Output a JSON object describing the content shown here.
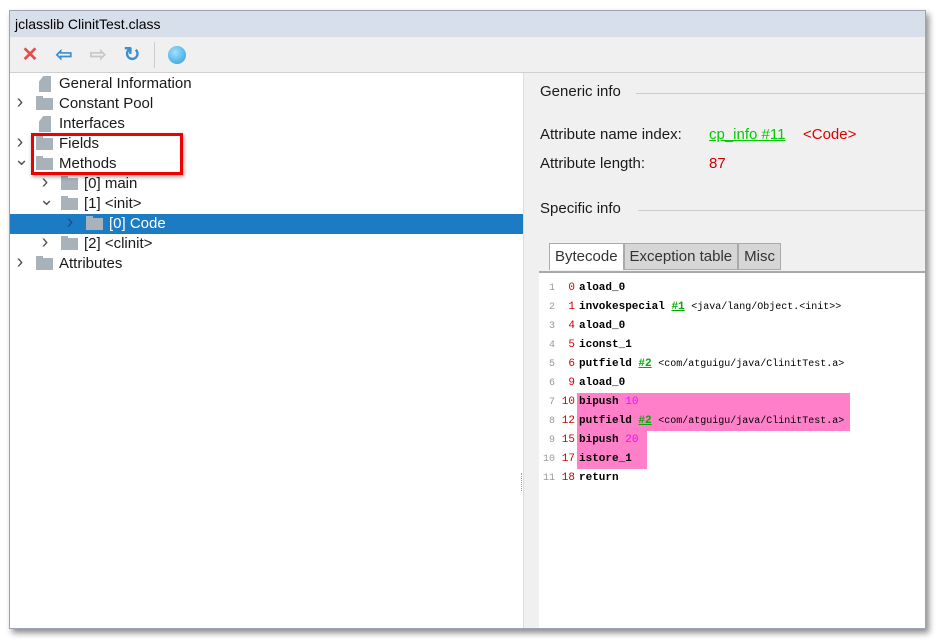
{
  "window": {
    "title": "jclasslib ClinitTest.class"
  },
  "toolbar": {
    "icons": [
      "close-icon",
      "back-icon",
      "forward-icon",
      "refresh-icon",
      "web-icon"
    ]
  },
  "tree": [
    {
      "label": "General Information",
      "level": 0,
      "kind": "file",
      "arrow": ""
    },
    {
      "label": "Constant Pool",
      "level": 0,
      "kind": "folder",
      "arrow": "collapsed"
    },
    {
      "label": "Interfaces",
      "level": 0,
      "kind": "file",
      "arrow": ""
    },
    {
      "label": "Fields",
      "level": 0,
      "kind": "folder",
      "arrow": "collapsed"
    },
    {
      "label": "Methods",
      "level": 0,
      "kind": "folder",
      "arrow": "expanded"
    },
    {
      "label": "[0] main",
      "level": 1,
      "kind": "folder",
      "arrow": "collapsed"
    },
    {
      "label": "[1] <init>",
      "level": 1,
      "kind": "folder",
      "arrow": "expanded"
    },
    {
      "label": "[0] Code",
      "level": 2,
      "kind": "folder",
      "arrow": "collapsed",
      "selected": true
    },
    {
      "label": "[2] <clinit>",
      "level": 1,
      "kind": "folder",
      "arrow": "collapsed"
    },
    {
      "label": "Attributes",
      "level": 0,
      "kind": "folder",
      "arrow": "collapsed"
    }
  ],
  "generic": {
    "title": "Generic info",
    "name_index_label": "Attribute name index:",
    "name_index_link": "cp_info #11",
    "name_index_value": "<Code>",
    "length_label": "Attribute length:",
    "length_value": "87"
  },
  "specific": {
    "title": "Specific info",
    "tabs": [
      "Bytecode",
      "Exception table",
      "Misc"
    ],
    "active_tab": "Bytecode"
  },
  "colors": {
    "selection": "#1b7cc4",
    "highlight": "#ff80c8",
    "link": "#00aa00",
    "value": "#cc0000"
  },
  "bytecode": [
    {
      "line": "1",
      "offset": "0",
      "op": "aload_0",
      "ref": "",
      "comment": "",
      "arg": ""
    },
    {
      "line": "2",
      "offset": "1",
      "op": "invokespecial",
      "ref": "#1",
      "comment": "<java/lang/Object.<init>>",
      "arg": ""
    },
    {
      "line": "3",
      "offset": "4",
      "op": "aload_0",
      "ref": "",
      "comment": "",
      "arg": ""
    },
    {
      "line": "4",
      "offset": "5",
      "op": "iconst_1",
      "ref": "",
      "comment": "",
      "arg": ""
    },
    {
      "line": "5",
      "offset": "6",
      "op": "putfield",
      "ref": "#2",
      "comment": "<com/atguigu/java/ClinitTest.a>",
      "arg": ""
    },
    {
      "line": "6",
      "offset": "9",
      "op": "aload_0",
      "ref": "",
      "comment": "",
      "arg": ""
    },
    {
      "line": "7",
      "offset": "10",
      "op": "bipush",
      "ref": "",
      "comment": "",
      "arg": "10",
      "hl": "wide"
    },
    {
      "line": "8",
      "offset": "12",
      "op": "putfield",
      "ref": "#2",
      "comment": "<com/atguigu/java/ClinitTest.a>",
      "arg": "",
      "hl": "wide"
    },
    {
      "line": "9",
      "offset": "15",
      "op": "bipush",
      "ref": "",
      "comment": "",
      "arg": "20",
      "hl": "narrow"
    },
    {
      "line": "10",
      "offset": "17",
      "op": "istore_1",
      "ref": "",
      "comment": "",
      "arg": "",
      "hl": "narrow"
    },
    {
      "line": "11",
      "offset": "18",
      "op": "return",
      "ref": "",
      "comment": "",
      "arg": ""
    }
  ]
}
